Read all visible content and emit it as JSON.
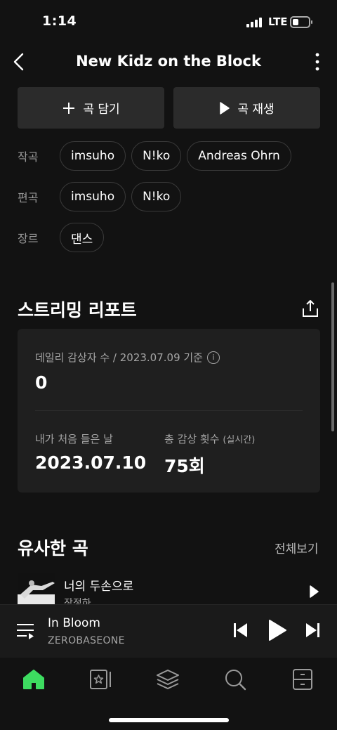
{
  "status_bar": {
    "time": "1:14",
    "network": "LTE"
  },
  "header": {
    "title": "New Kidz on the Block"
  },
  "actions": {
    "add_label": "곡 담기",
    "play_label": "곡 재생"
  },
  "credits": [
    {
      "label": "작곡",
      "chips": [
        "imsuho",
        "N!ko",
        "Andreas Ohrn"
      ]
    },
    {
      "label": "편곡",
      "chips": [
        "imsuho",
        "N!ko"
      ]
    },
    {
      "label": "장르",
      "chips": [
        "댄스"
      ]
    }
  ],
  "streaming_report": {
    "title": "스트리밍 리포트",
    "daily_label": "데일리 감상자 수 / 2023.07.09 기준",
    "daily_value": "0",
    "first_listen_label": "내가 처음 들은 날",
    "first_listen_value": "2023.07.10",
    "total_label": "총 감상 횟수",
    "total_label_note": "(실시간)",
    "total_value": "75회"
  },
  "similar": {
    "title": "유사한 곡",
    "see_all": "전체보기",
    "songs": [
      {
        "title": "너의 두손으로",
        "artist": "장정하"
      }
    ]
  },
  "now_playing": {
    "title": "In Bloom",
    "artist": "ZEROBASEONE"
  },
  "colors": {
    "accent": "#3ddc60",
    "background": "#121212",
    "card": "#1f1f1f"
  },
  "tabs": [
    "home-icon",
    "library-icon",
    "layers-icon",
    "search-icon",
    "storage-icon"
  ]
}
